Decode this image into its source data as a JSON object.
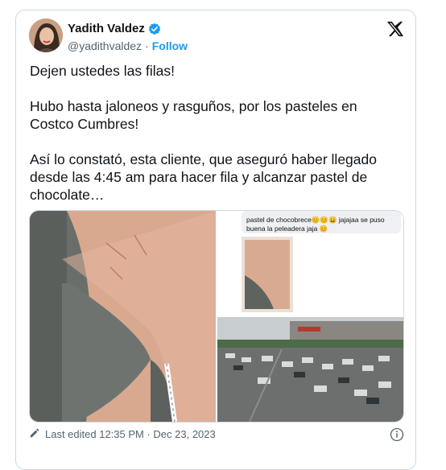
{
  "author": {
    "name": "Yadith Valdez",
    "handle": "@yadithvaldez",
    "separator": "·",
    "follow_label": "Follow"
  },
  "tweet": {
    "paragraphs": [
      "Dejen ustedes las filas!",
      "Hubo hasta jaloneos y rasguños, por los pasteles en Costco Cumbres!",
      "Así lo constató, esta cliente, que aseguró haber llegado desde las 4:45 am para hacer fila y alcanzar pastel de chocolate…"
    ]
  },
  "media": {
    "chat_text": "pastel de chocobrece😊😊😄 jajajaa se puso buena la peleadera jaja 😊"
  },
  "footer": {
    "edited_text": "Last edited 12:35 PM · Dec 23, 2023"
  },
  "icons": {
    "verified": "verified-badge-icon",
    "x": "x-logo-icon",
    "edit": "pencil-icon",
    "info": "info-icon"
  },
  "colors": {
    "link": "#1d9bf0",
    "muted": "#536471",
    "border": "#cfd9de"
  }
}
